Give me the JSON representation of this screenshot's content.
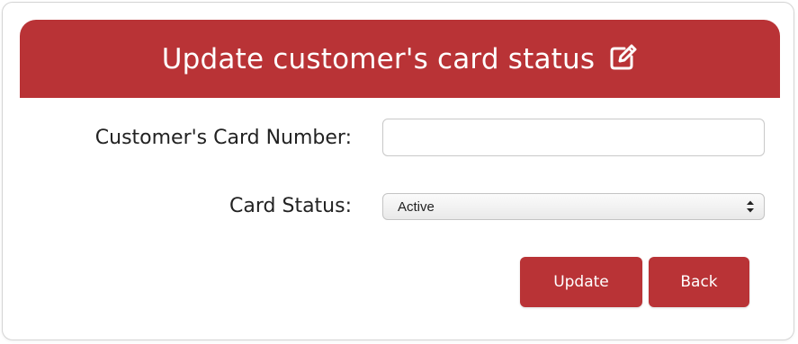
{
  "header": {
    "title": "Update customer's card status",
    "icon": "edit-icon",
    "background_color": "#b93336",
    "text_color": "#ffffff"
  },
  "form": {
    "card_number": {
      "label": "Customer's Card Number:",
      "value": "",
      "placeholder": ""
    },
    "card_status": {
      "label": "Card Status:",
      "selected": "Active",
      "icon": "select-arrows-icon"
    }
  },
  "actions": {
    "update_label": "Update",
    "back_label": "Back",
    "button_color": "#b93336"
  }
}
